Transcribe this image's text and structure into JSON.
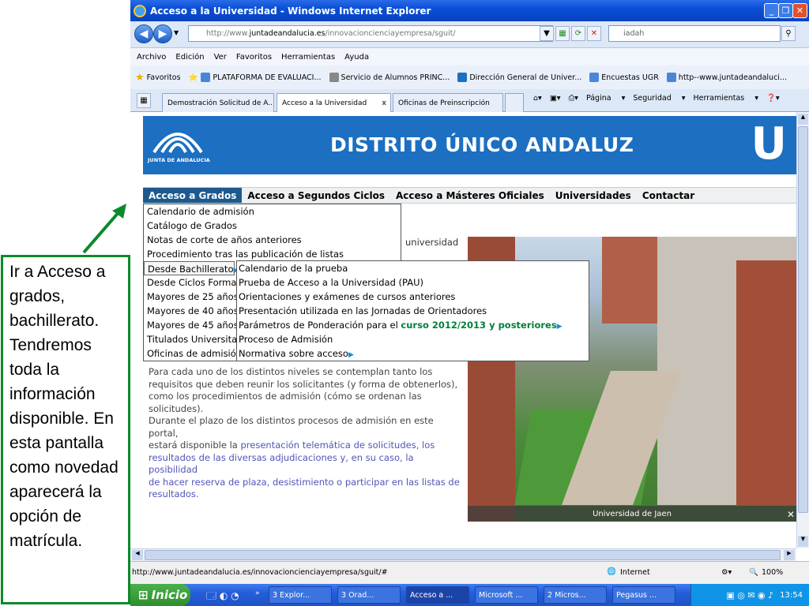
{
  "window": {
    "title": "Acceso a la Universidad - Windows Internet Explorer"
  },
  "address": {
    "prefix": "http://www.",
    "domain": "juntadeandalucia.es",
    "path": "/innovacioncienciayempresa/sguit/"
  },
  "search": {
    "value": "iadah"
  },
  "menu": [
    "Archivo",
    "Edición",
    "Ver",
    "Favoritos",
    "Herramientas",
    "Ayuda"
  ],
  "favorites": {
    "label": "Favoritos",
    "items": [
      "PLATAFORMA DE EVALUACI...",
      "Servicio de Alumnos PRINC...",
      "Dirección General de Univer...",
      "Encuestas UGR",
      "http--www.juntadeandaluci..."
    ]
  },
  "tabs": [
    {
      "label": "Demostración Solicitud de A..."
    },
    {
      "label": "Acceso a la Universidad"
    },
    {
      "label": "Oficinas de Preinscripción"
    }
  ],
  "commands": {
    "page": "Página",
    "security": "Seguridad",
    "tools": "Herramientas"
  },
  "banner": {
    "title": "DISTRITO ÚNICO ANDALUZ",
    "junta": "JUNTA DE ANDALUCIA",
    "ulogo": "U"
  },
  "nav": [
    "Acceso a Grados",
    "Acceso a Segundos Ciclos",
    "Acceso a Másteres Oficiales",
    "Universidades",
    "Contactar"
  ],
  "dropdown1": [
    "Calendario de admisión",
    "Catálogo de Grados",
    "Notas de corte de años anteriores",
    "Procedimiento tras las publicación de listas",
    "Desde Bachillerato",
    "Desde Ciclos Format",
    "Mayores de 25 años",
    "Mayores de 40 años",
    "Mayores de 45 años",
    "Titulados Universitar",
    "Oficinas de admisión"
  ],
  "dropdown2": {
    "items": [
      "Calendario de la prueba",
      "Prueba de Acceso a la Universidad (PAU)",
      "Orientaciones y exámenes de cursos anteriores",
      "Presentación utilizada en las Jornadas de Orientadores"
    ],
    "ponderacion": "Parámetros de Ponderación para el",
    "ponderacion_link": "curso 2012/2013 y posteriores",
    "items2": [
      "Proceso de Admisión",
      "Normativa sobre acceso"
    ]
  },
  "page": {
    "universidad": "universidad",
    "p1_lines": [
      "Para cada uno de los distintos niveles se contemplan tanto los",
      "requisitos que deben reunir los solicitantes (y forma de obtenerlos),",
      "como los procedimientos de admisión (cómo se ordenan las",
      "solicitudes)."
    ],
    "p2_line1": "Durante el plazo de los distintos procesos de admisión en este portal,",
    "p2_line2a": "estará disponible la ",
    "p2_line2b": "presentación telemática de solicitudes, los",
    "p2_lines_link": [
      "resultados de las diversas adjudicaciones y, en su caso, la posibilidad",
      "de hacer reserva de plaza, desistimiento o participar en las listas de",
      "resultados."
    ],
    "photo_caption": "Universidad de Jaen"
  },
  "status": {
    "url": "http://www.juntadeandalucia.es/innovacioncienciayempresa/sguit/#",
    "zone": "Internet",
    "zoom": "100%"
  },
  "taskbar": {
    "start": "Inicio",
    "items": [
      "3 Explor...",
      "3 Orad...",
      "Acceso a ...",
      "Microsoft ...",
      "2 Micros...",
      "Pegasus ..."
    ],
    "clock": "13:54"
  },
  "annotation": "Ir a Acceso a grados, bachillerato. Tendremos toda la información disponible. En esta pantalla como novedad aparecerá la opción de matrícula.",
  "colors": {
    "banner": "#1c6fc1",
    "annotation_border": "#0b8a2a",
    "nav_selected": "#1c5a8e",
    "link_green": "#00803a"
  }
}
